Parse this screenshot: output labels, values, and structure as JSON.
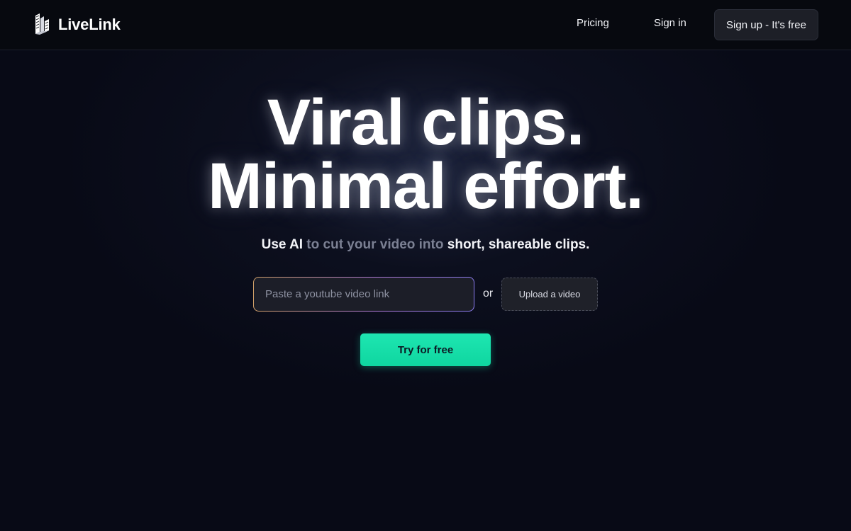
{
  "nav": {
    "brand_name": "LiveLink",
    "logo_icon": "livelink-logo-icon",
    "links": [
      {
        "label": "Pricing"
      },
      {
        "label": "Sign in"
      }
    ],
    "signup_label": "Sign up - It's free"
  },
  "hero": {
    "title_line1": "Viral clips.",
    "title_line2": "Minimal effort.",
    "subtitle": {
      "part1": "Use AI",
      "part2": " to cut your video into ",
      "part3": "short, shareable clips."
    }
  },
  "form": {
    "url_placeholder": "Paste a youtube video link",
    "url_value": "",
    "or_label": "or",
    "upload_label": "Upload a video",
    "cta_label": "Try for free"
  },
  "colors": {
    "background": "#080a16",
    "cta": "#12dca6",
    "muted_text": "#7b8093"
  }
}
